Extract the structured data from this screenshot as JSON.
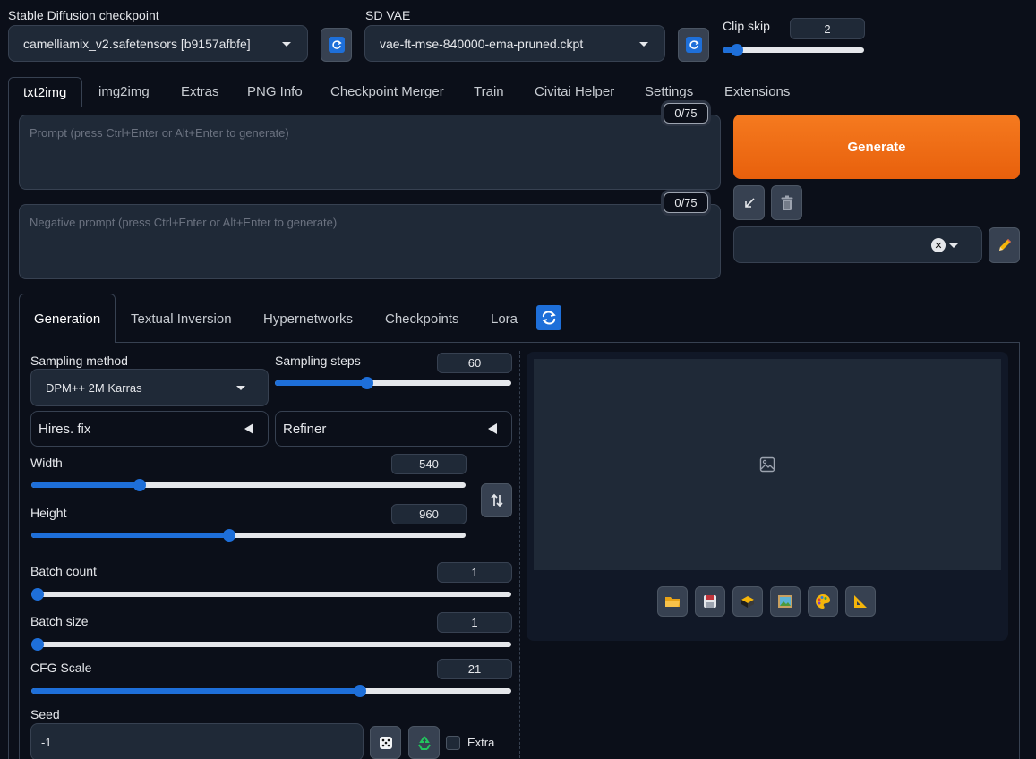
{
  "header": {
    "checkpoint_label": "Stable Diffusion checkpoint",
    "checkpoint_value": "camelliamix_v2.safetensors [b9157afbfe]",
    "vae_label": "SD VAE",
    "vae_value": "vae-ft-mse-840000-ema-pruned.ckpt",
    "clip_skip_label": "Clip skip",
    "clip_skip_value": "2",
    "clip_skip_level": 0.1
  },
  "main_tabs": [
    "txt2img",
    "img2img",
    "Extras",
    "PNG Info",
    "Checkpoint Merger",
    "Train",
    "Civitai Helper",
    "Settings",
    "Extensions"
  ],
  "prompt": {
    "placeholder": "Prompt (press Ctrl+Enter or Alt+Enter to generate)",
    "counter": "0/75"
  },
  "negative_prompt": {
    "placeholder": "Negative prompt (press Ctrl+Enter or Alt+Enter to generate)",
    "counter": "0/75"
  },
  "generate_label": "Generate",
  "sub_tabs": [
    "Generation",
    "Textual Inversion",
    "Hypernetworks",
    "Checkpoints",
    "Lora"
  ],
  "sampling": {
    "method_label": "Sampling method",
    "method_value": "DPM++ 2M Karras",
    "steps_label": "Sampling steps",
    "steps_value": "60",
    "steps_level": 0.39
  },
  "hires_label": "Hires. fix",
  "refiner_label": "Refiner",
  "width": {
    "label": "Width",
    "value": "540",
    "level": 0.25
  },
  "height": {
    "label": "Height",
    "value": "960",
    "level": 0.455
  },
  "batch_count": {
    "label": "Batch count",
    "value": "1",
    "level": 0.0
  },
  "batch_size": {
    "label": "Batch size",
    "value": "1",
    "level": 0.0
  },
  "cfg": {
    "label": "CFG Scale",
    "value": "21",
    "level": 0.685
  },
  "seed": {
    "label": "Seed",
    "value": "-1",
    "extra_label": "Extra"
  },
  "colors": {
    "accent": "#1e6fd9",
    "generate": "#f26b16",
    "bg": "#0b0f19",
    "panel": "#1f2937"
  }
}
